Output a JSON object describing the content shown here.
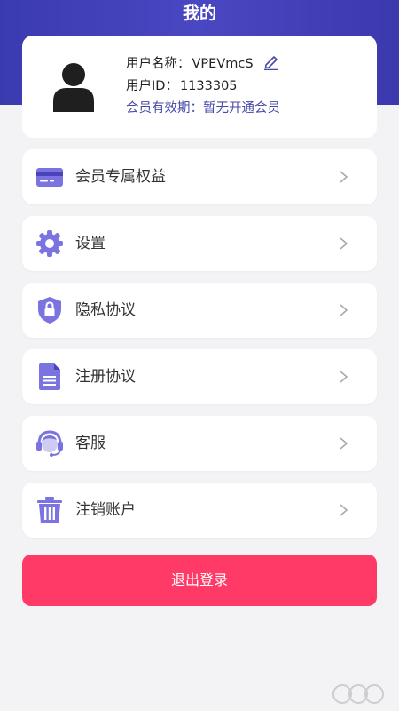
{
  "header": {
    "title": "我的",
    "bg_color": "#4a47c2"
  },
  "profile": {
    "username_label": "用户名称：",
    "username": "VPEVmcS",
    "userid_label": "用户ID：",
    "userid": "1133305",
    "vip_status": "会员有效期：暂无开通会员",
    "avatar_icon": "user-avatar-icon",
    "edit_icon": "pencil-edit-icon"
  },
  "menu": [
    {
      "label": "会员专属权益",
      "icon": "card-icon"
    },
    {
      "label": "设置",
      "icon": "gear-icon"
    },
    {
      "label": "隐私协议",
      "icon": "shield-lock-icon"
    },
    {
      "label": "注册协议",
      "icon": "document-icon"
    },
    {
      "label": "客服",
      "icon": "headset-icon"
    },
    {
      "label": "注销账户",
      "icon": "trash-icon"
    }
  ],
  "logout": {
    "label": "退出登录",
    "color": "#ff3a67"
  },
  "colors": {
    "accent": "#7b74e0",
    "vip_text": "#4a4aa8"
  }
}
